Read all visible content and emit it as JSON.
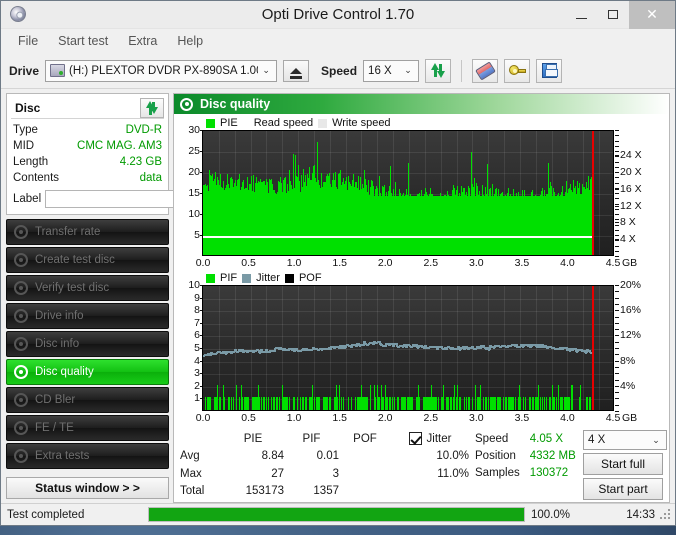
{
  "window": {
    "title": "Opti Drive Control 1.70",
    "app_icon": "disc-icon",
    "minimize": "minimize-icon",
    "maximize": "maximize-icon",
    "close": "close-icon"
  },
  "menu": {
    "items": [
      "File",
      "Start test",
      "Extra",
      "Help"
    ]
  },
  "toolbar": {
    "drive_label": "Drive",
    "drive_value": "(H:)  PLEXTOR DVDR   PX-890SA 1.00",
    "eject_title": "eject",
    "speed_label": "Speed",
    "speed_value": "16 X",
    "refresh_title": "refresh",
    "erase_title": "erase",
    "key_title": "tools",
    "save_title": "save"
  },
  "disc": {
    "header": "Disc",
    "refresh_icon": "refresh-icon",
    "rows": [
      {
        "key": "Type",
        "value": "DVD-R"
      },
      {
        "key": "MID",
        "value": "CMC MAG. AM3"
      },
      {
        "key": "Length",
        "value": "4.23 GB"
      },
      {
        "key": "Contents",
        "value": "data"
      }
    ],
    "label_key": "Label",
    "label_value": "",
    "label_placeholder": "",
    "cd_button_icon": "cd-icon"
  },
  "nav": {
    "items": [
      {
        "label": "Transfer rate",
        "active": false
      },
      {
        "label": "Create test disc",
        "active": false
      },
      {
        "label": "Verify test disc",
        "active": false
      },
      {
        "label": "Drive info",
        "active": false
      },
      {
        "label": "Disc info",
        "active": false
      },
      {
        "label": "Disc quality",
        "active": true
      },
      {
        "label": "CD Bler",
        "active": false
      },
      {
        "label": "FE / TE",
        "active": false
      },
      {
        "label": "Extra tests",
        "active": false
      }
    ],
    "status_window_button": "Status window > >"
  },
  "main": {
    "header_title": "Disc quality",
    "header_icon": "disc-quality-icon"
  },
  "chart_data": [
    {
      "type": "bar",
      "title": "PIE",
      "legend": [
        {
          "label": "PIE",
          "color": "#00e000"
        },
        {
          "label": "Read speed",
          "color": "#ffffff"
        },
        {
          "label": "Write speed",
          "color": "#e8e8e8"
        }
      ],
      "xlabel": "GB",
      "xticks": [
        "0.0",
        "0.5",
        "1.0",
        "1.5",
        "2.0",
        "2.5",
        "3.0",
        "3.5",
        "4.0",
        "4.5"
      ],
      "xlim": [
        0.0,
        4.5
      ],
      "ylabel_left": "PIE",
      "yticks_left": [
        "30",
        "25",
        "20",
        "15",
        "10",
        "5"
      ],
      "ylim_left": [
        0,
        30
      ],
      "ylabel_right": "Speed",
      "yticks_right": [
        "24 X",
        "20 X",
        "16 X",
        "12 X",
        "8 X",
        "4 X"
      ],
      "ylim_right": [
        0,
        30
      ],
      "read_speed_line": 5,
      "data_end_gb": 4.25,
      "grid": true,
      "avg": 8.84,
      "max": 27,
      "total": 153173
    },
    {
      "type": "bar",
      "title": "PIF",
      "legend": [
        {
          "label": "PIF",
          "color": "#00e000"
        },
        {
          "label": "Jitter",
          "color": "#7a9aa6"
        },
        {
          "label": "POF",
          "color": "#000000"
        }
      ],
      "xlabel": "GB",
      "xticks": [
        "0.0",
        "0.5",
        "1.0",
        "1.5",
        "2.0",
        "2.5",
        "3.0",
        "3.5",
        "4.0",
        "4.5"
      ],
      "xlim": [
        0.0,
        4.5
      ],
      "ylabel_left": "PIF",
      "yticks_left": [
        "10",
        "9",
        "8",
        "7",
        "6",
        "5",
        "4",
        "3",
        "2",
        "1"
      ],
      "ylim_left": [
        0,
        10
      ],
      "ylabel_right": "Jitter",
      "yticks_right": [
        "20%",
        "16%",
        "12%",
        "8%",
        "4%"
      ],
      "ylim_right": [
        0,
        20
      ],
      "jitter_mean_pct": 10.0,
      "data_end_gb": 4.25,
      "grid": true,
      "avg": 0.01,
      "max": 3,
      "total": 1357
    }
  ],
  "stats": {
    "columns": [
      "PIE",
      "PIF",
      "POF",
      "Jitter"
    ],
    "jitter_checked": true,
    "rows": [
      {
        "label": "Avg",
        "pie": "8.84",
        "pif": "0.01",
        "pof": "",
        "jitter": "10.0%"
      },
      {
        "label": "Max",
        "pie": "27",
        "pif": "3",
        "pof": "",
        "jitter": "11.0%"
      },
      {
        "label": "Total",
        "pie": "153173",
        "pif": "1357",
        "pof": "",
        "jitter": ""
      }
    ],
    "right": [
      {
        "key": "Speed",
        "value": "4.05 X"
      },
      {
        "key": "Position",
        "value": "4332 MB"
      },
      {
        "key": "Samples",
        "value": "130372"
      }
    ],
    "speed_select": "4 X",
    "start_full": "Start full",
    "start_part": "Start part"
  },
  "statusbar": {
    "message": "Test completed",
    "progress_percent": 100,
    "progress_text": "100.0%",
    "time": "14:33"
  },
  "colors": {
    "accent_green": "#00e000",
    "value_green": "#009a00",
    "marker_red": "#e80000",
    "jitter_blue": "#7a9aa6",
    "plot_bg": "#2d2d2d"
  }
}
